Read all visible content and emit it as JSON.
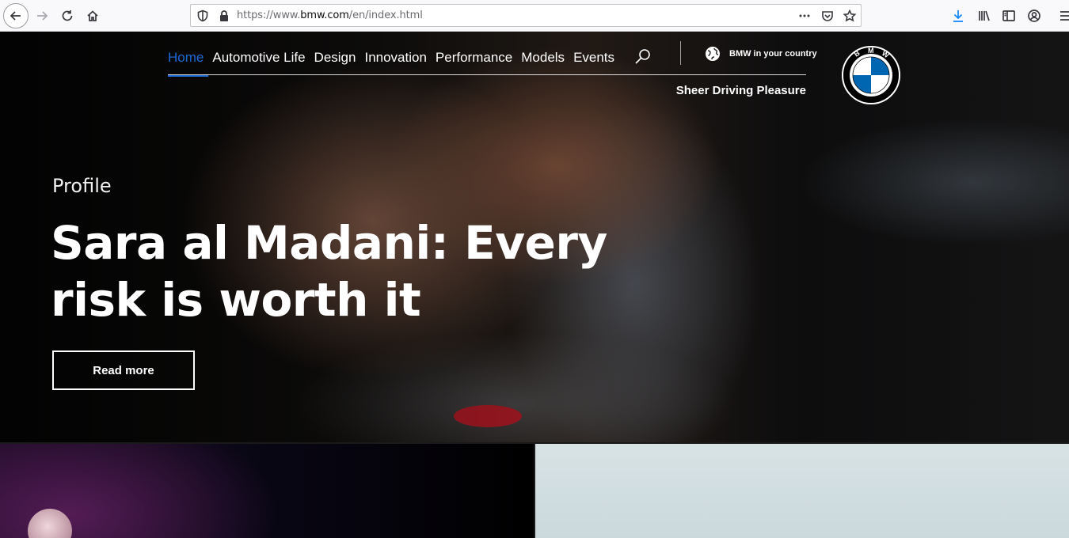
{
  "browser": {
    "url_prefix": "https://www.",
    "url_domain": "bmw.com",
    "url_path": "/en/index.html"
  },
  "nav": {
    "items": [
      {
        "label": "Home",
        "active": true
      },
      {
        "label": "Automotive Life"
      },
      {
        "label": "Design"
      },
      {
        "label": "Innovation"
      },
      {
        "label": "Performance"
      },
      {
        "label": "Models"
      },
      {
        "label": "Events"
      }
    ],
    "country_link": "BMW in your country",
    "tagline": "Sheer Driving Pleasure",
    "logo_letters": "BMW"
  },
  "hero": {
    "eyebrow": "Profile",
    "headline": "Sara al Madani: Every risk is worth it",
    "cta": "Read more"
  },
  "colors": {
    "accent": "#1c69d4",
    "logo_blue": "#0066b1"
  }
}
